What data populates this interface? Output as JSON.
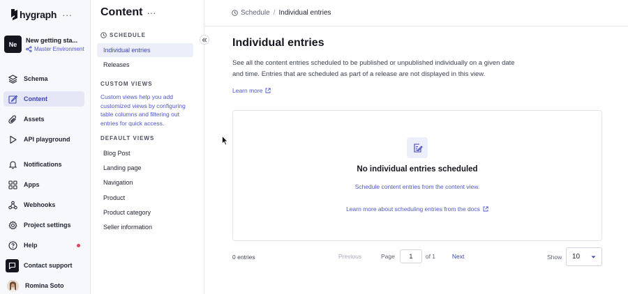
{
  "brand": {
    "name": "hygraph",
    "more": "···"
  },
  "project": {
    "initials": "Ne",
    "name": "New getting sta...",
    "environment": "Master Environment"
  },
  "nav": {
    "items": [
      {
        "label": "Schema",
        "icon": "schema-icon"
      },
      {
        "label": "Content",
        "icon": "content-edit-icon",
        "active": true
      },
      {
        "label": "Assets",
        "icon": "paperclip-icon"
      },
      {
        "label": "API playground",
        "icon": "play-icon"
      },
      {
        "label": "Notifications",
        "icon": "bell-icon"
      },
      {
        "label": "Apps",
        "icon": "grid-icon"
      },
      {
        "label": "Webhooks",
        "icon": "webhook-icon"
      },
      {
        "label": "Project settings",
        "icon": "gear-icon"
      },
      {
        "label": "Help",
        "icon": "help-icon"
      },
      {
        "label": "Contact support",
        "icon": "chat-icon"
      },
      {
        "label": "Romina Soto",
        "icon": "avatar"
      }
    ]
  },
  "panel": {
    "title": "Content",
    "more": "···",
    "schedule_heading": "SCHEDULE",
    "schedule_items": [
      "Individual entries",
      "Releases"
    ],
    "custom_views_heading": "CUSTOM VIEWS",
    "custom_views_desc": "Custom views help you add customized views by configuring table columns and filtering out entries for quick access.",
    "default_views_heading": "DEFAULT VIEWS",
    "default_views": [
      "Blog Post",
      "Landing page",
      "Navigation",
      "Product",
      "Product category",
      "Seller information"
    ]
  },
  "breadcrumb": {
    "parent": "Schedule",
    "separator": "/",
    "current": "Individual entries"
  },
  "main": {
    "title": "Individual entries",
    "description": "See all the content entries scheduled to be published or unpublished individually on a given date and time. Entries that are scheduled as part of a release are not displayed in this view.",
    "learn_more": "Learn more",
    "empty": {
      "title": "No individual entries scheduled",
      "subtitle": "Schedule content entries from the content view.",
      "docs_link": "Learn more about scheduling entries from the docs"
    }
  },
  "pagination": {
    "count": "0 entries",
    "previous": "Previous",
    "page_label": "Page",
    "page_value": "1",
    "of_label": "of 1",
    "next": "Next",
    "show_label": "Show",
    "show_value": "10"
  },
  "colors": {
    "accent": "#4f56c9",
    "active_bg": "#e5e6f6",
    "dark": "#14151f"
  }
}
